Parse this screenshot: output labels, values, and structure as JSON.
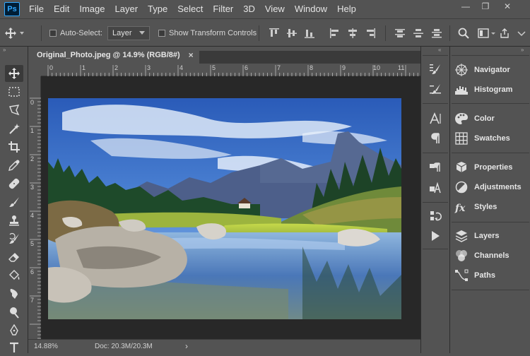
{
  "app": {
    "logo": "Ps"
  },
  "menu": [
    "File",
    "Edit",
    "Image",
    "Layer",
    "Type",
    "Select",
    "Filter",
    "3D",
    "View",
    "Window",
    "Help"
  ],
  "window_controls": {
    "minimize": "—",
    "restore": "❐",
    "close": "✕"
  },
  "options": {
    "auto_select_label": "Auto-Select:",
    "auto_select_value": "Layer",
    "show_transform_label": "Show Transform Controls"
  },
  "document": {
    "tab_title": "Original_Photo.jpeg @ 14.9% (RGB/8#)",
    "tab_close": "×",
    "ruler_h": [
      "0",
      "1",
      "2",
      "3",
      "4",
      "5",
      "6",
      "7",
      "8",
      "9",
      "10",
      "11"
    ],
    "ruler_v": [
      "0",
      "1",
      "2",
      "3",
      "4",
      "5",
      "6",
      "7"
    ]
  },
  "status": {
    "zoom": "14.88%",
    "doc_size": "Doc: 20.3M/20.3M",
    "arrow": "›"
  },
  "panels": {
    "navigator": "Navigator",
    "histogram": "Histogram",
    "color": "Color",
    "swatches": "Swatches",
    "properties": "Properties",
    "adjustments": "Adjustments",
    "styles": "Styles",
    "layers": "Layers",
    "channels": "Channels",
    "paths": "Paths"
  },
  "colors": {
    "accent": "#31a8ff",
    "ui_bg": "#535353",
    "canvas_bg": "#282828"
  }
}
